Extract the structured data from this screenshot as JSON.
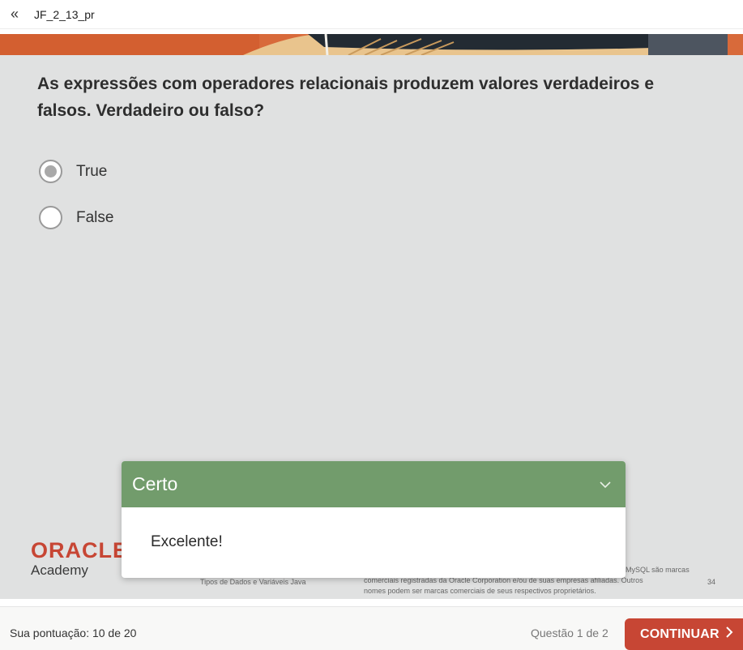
{
  "header": {
    "back_icon": "double-chevron-left-icon",
    "doc_title": "JF_2_13_pr"
  },
  "slide": {
    "question": "As expressões com operadores relacionais produzem valores verdadeiros e falsos. Verdadeiro ou falso?",
    "options": [
      {
        "label": "True",
        "selected": true
      },
      {
        "label": "False",
        "selected": false
      }
    ],
    "logo_brand": "ORACLE",
    "logo_sub": "Academy",
    "footer_left": "Tipos de Dados e Variáveis Java",
    "footer_right_line1": "MySQL são marcas",
    "footer_right_line2": "comerciais registradas da Oracle Corporation e/ou de suas empresas afiliadas. Outros",
    "footer_right_line3": "nomes podem ser marcas comerciais de seus respectivos proprietários.",
    "page_number": "34"
  },
  "feedback": {
    "title": "Certo",
    "message": "Excelente!",
    "collapse_icon": "chevron-down-icon",
    "color": "#729c6c"
  },
  "footer": {
    "score": "Sua pontuação: 10 de 20",
    "question_count": "Questão 1 de 2",
    "continue_label": "CONTINUAR",
    "accent": "#c74634"
  }
}
